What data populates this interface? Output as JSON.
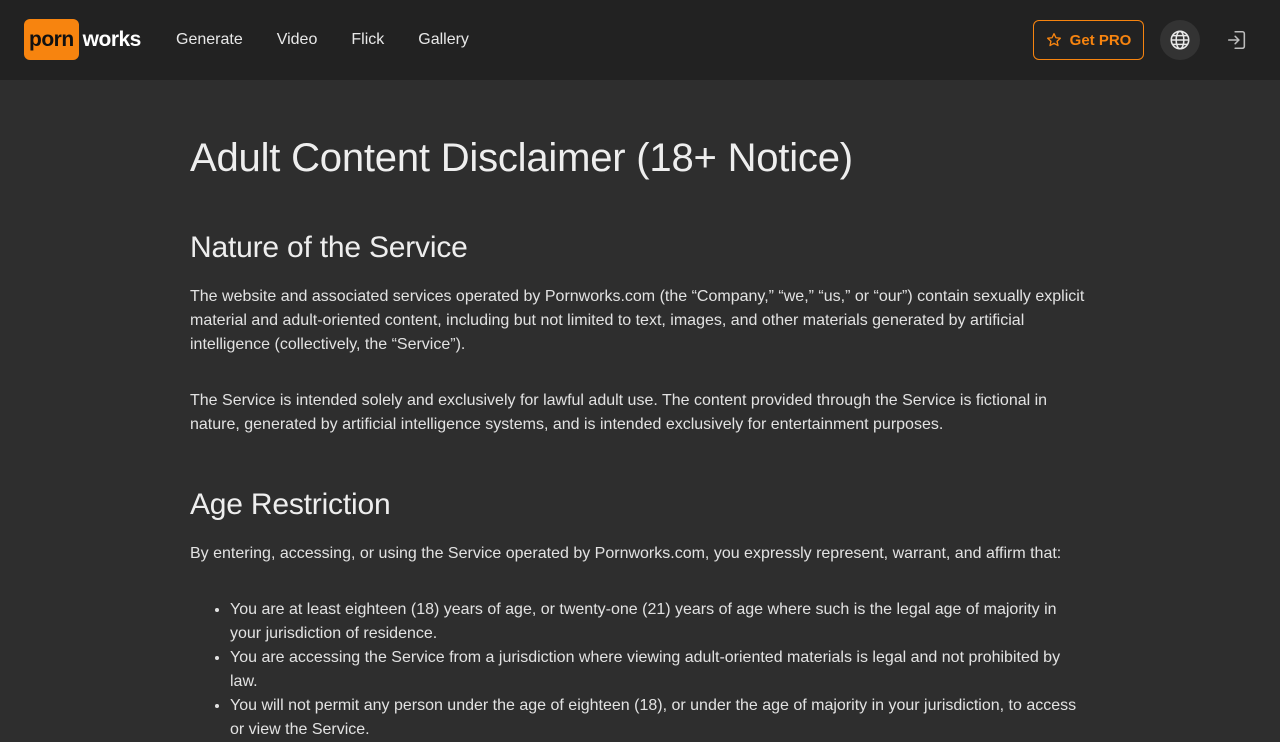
{
  "header": {
    "logo_part1": "porn",
    "logo_part2": "works",
    "nav": [
      {
        "label": "Generate"
      },
      {
        "label": "Video"
      },
      {
        "label": "Flick"
      },
      {
        "label": "Gallery"
      }
    ],
    "pro_label": "Get PRO",
    "icons": {
      "pro": "star-icon",
      "language": "globe-icon",
      "login": "sign-in-icon"
    },
    "colors": {
      "accent": "#f7840f",
      "bar": "#222222",
      "page": "#2e2e2e"
    }
  },
  "main": {
    "title": "Adult Content Disclaimer (18+ Notice)",
    "section1": {
      "heading": "Nature of the Service",
      "p1": "The website and associated services operated by Pornworks.com (the “Company,” “we,” “us,” or “our”) contain sexually explicit material and adult-oriented content, including but not limited to text, images, and other materials generated by artificial intelligence (collectively, the “Service”).",
      "p2": "The Service is intended solely and exclusively for lawful adult use. The content provided through the Service is fictional in nature, generated by artificial intelligence systems, and is intended exclusively for entertainment purposes."
    },
    "section2": {
      "heading": "Age Restriction",
      "intro": "By entering, accessing, or using the Service operated by Pornworks.com, you expressly represent, warrant, and affirm that:",
      "items": [
        "You are at least eighteen (18) years of age, or twenty-one (21) years of age where such is the legal age of majority in your jurisdiction of residence.",
        "You are accessing the Service from a jurisdiction where viewing adult-oriented materials is legal and not prohibited by law.",
        "You will not permit any person under the age of eighteen (18), or under the age of majority in your jurisdiction, to access or view the Service."
      ]
    }
  }
}
